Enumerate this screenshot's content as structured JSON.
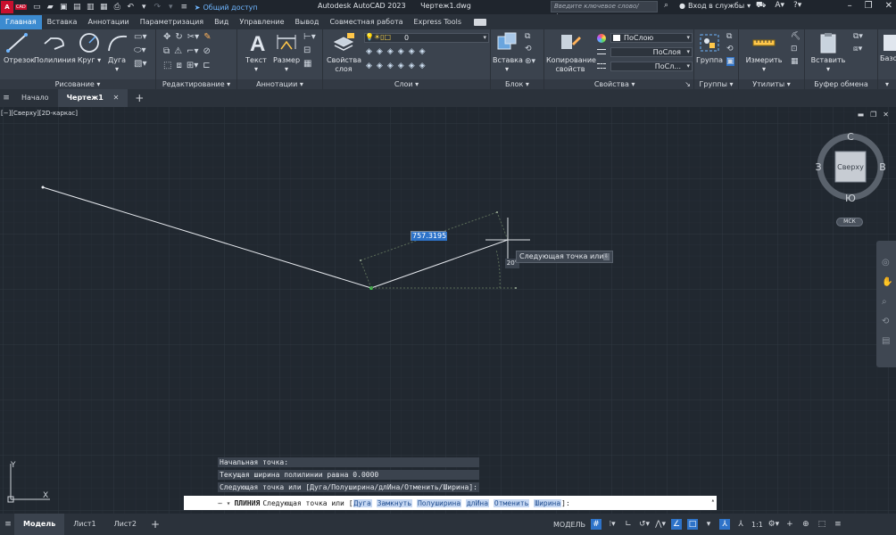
{
  "titlebar": {
    "logo": "A",
    "logo_tag": "CAD",
    "share_label": "Общий доступ",
    "app_title": "Autodesk AutoCAD 2023",
    "file_title": "Чертеж1.dwg",
    "search_placeholder": "Введите ключевое слово/фразу",
    "signin_label": "Вход в службы"
  },
  "ribbon_tabs": [
    "Главная",
    "Вставка",
    "Аннотации",
    "Параметризация",
    "Вид",
    "Управление",
    "Вывод",
    "Совместная работа",
    "Express Tools"
  ],
  "active_tab": "Главная",
  "panels": {
    "draw": {
      "title": "Рисование",
      "buttons": [
        "Отрезок",
        "Полилиния",
        "Круг",
        "Дуга"
      ]
    },
    "modify": {
      "title": "Редактирование"
    },
    "annotation": {
      "title": "Аннотации",
      "buttons": [
        "Текст",
        "Размер"
      ]
    },
    "layers": {
      "title": "Слои",
      "button_line1": "Свойства",
      "button_line2": "слоя",
      "layer_value": "0"
    },
    "block": {
      "title": "Блок",
      "button": "Вставка"
    },
    "properties": {
      "title": "Свойства",
      "button_line1": "Копирование",
      "button_line2": "свойств",
      "color_value": "ПоСлою",
      "linetype_value": "ПоСлоя",
      "lineweight_value": "ПоСл..."
    },
    "groups": {
      "title": "Группы",
      "button": "Группа"
    },
    "utilities": {
      "title": "Утилиты",
      "button": "Измерить"
    },
    "clipboard": {
      "title": "Буфер обмена",
      "button": "Вставить"
    },
    "base": {
      "button": "Базо"
    }
  },
  "doc_tabs": {
    "start": "Начало",
    "active": "Чертеж1"
  },
  "viewport": {
    "label": "[−][Сверху][2D-каркас]",
    "viewcube": {
      "north": "С",
      "south": "Ю",
      "west": "З",
      "east": "В",
      "face": "Сверху"
    },
    "ucs_badge": "МСК",
    "dynamic_input_value": "757.3195",
    "angle_value": "20°",
    "tooltip": "Следующая точка или",
    "ucs_y": "Y",
    "ucs_x": "X"
  },
  "command_history": [
    "Начальная точка:",
    "Текущая ширина полилинии равна 0.0000",
    "Следующая точка или [Дуга/Полуширина/длИна/Отменить/Ширина]:"
  ],
  "command_line": {
    "command": "ПЛИНИЯ",
    "prompt": "Следующая точка или [",
    "options": [
      "Дуга",
      "Замкнуть",
      "Полуширина",
      "длИна",
      "Отменить",
      "Ширина"
    ],
    "suffix": "]:"
  },
  "status": {
    "layout_tabs": [
      "Модель",
      "Лист1",
      "Лист2"
    ],
    "active_layout": "Модель",
    "space_label": "МОДЕЛЬ",
    "scale": "1:1"
  }
}
